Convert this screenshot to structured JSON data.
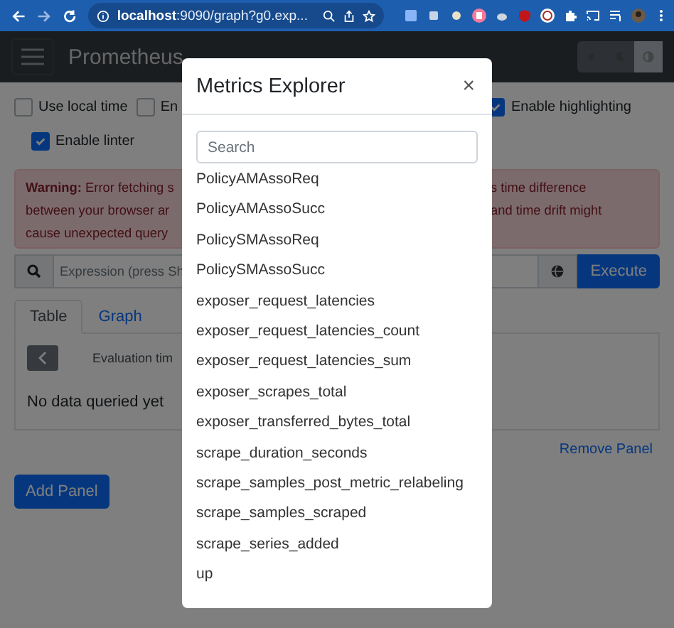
{
  "browser": {
    "address": "**localhost**:9090/graph?g0.exp..."
  },
  "navbar": {
    "brand": "Prometheus",
    "theme_buttons": [
      {
        "selected": false
      },
      {
        "selected": false
      },
      {
        "selected": true
      }
    ]
  },
  "options": [
    {
      "label": "Use local time",
      "checked": false
    },
    {
      "label": "En",
      "checked": false
    },
    {
      "label": "Enable highlighting",
      "checked": true
    },
    {
      "label": "Enable linter",
      "checked": true
    }
  ],
  "warning": {
    "left_lines": [
      "**Warning:** Error fetching s",
      "between your browser ar",
      "cause unexpected query"
    ],
    "right_lines": [
      "s time difference",
      "and time drift might"
    ]
  },
  "expression": {
    "placeholder": "Expression (press Sh",
    "button": "Execute"
  },
  "tabs": [
    {
      "label": "Table",
      "selected": true
    },
    {
      "label": "Graph",
      "selected": false
    }
  ],
  "panel": {
    "evaluation_label": "Evaluation tim",
    "empty_text": "No data queried yet",
    "remove": "Remove Panel"
  },
  "add_panel": "Add Panel",
  "modal": {
    "title": "Metrics Explorer",
    "close": "×",
    "search_placeholder": "Search",
    "metrics": [
      "PolicyAMAssoReq",
      "PolicyAMAssoSucc",
      "PolicySMAssoReq",
      "PolicySMAssoSucc",
      "exposer_request_latencies",
      "exposer_request_latencies_count",
      "exposer_request_latencies_sum",
      "exposer_scrapes_total",
      "exposer_transferred_bytes_total",
      "scrape_duration_seconds",
      "scrape_samples_post_metric_relabeling",
      "scrape_samples_scraped",
      "scrape_series_added",
      "up"
    ]
  }
}
